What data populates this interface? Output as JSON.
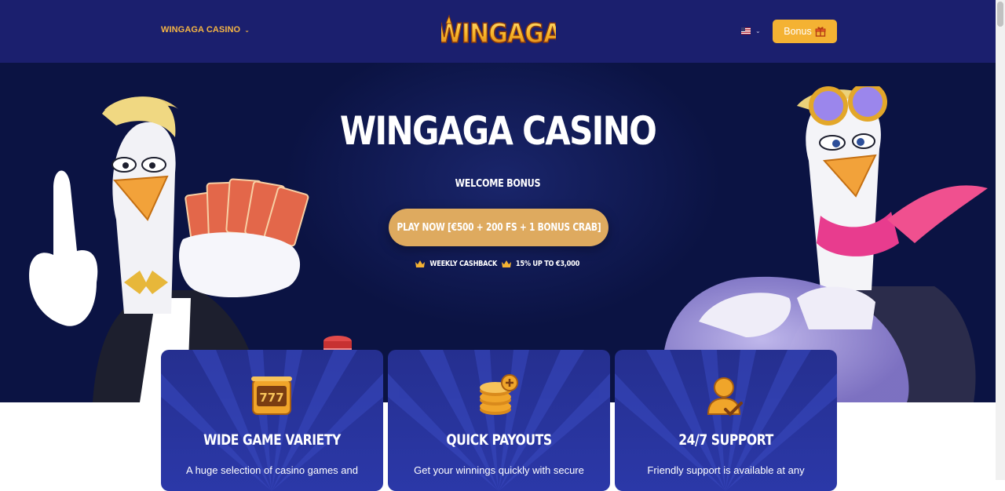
{
  "header": {
    "nav_label": "WINGAGA CASINO",
    "logo_text": "WINGAGA",
    "language_icon": "us-flag-icon",
    "bonus_label": "Bonus",
    "bonus_icon": "gift-icon"
  },
  "hero": {
    "title": "WINGAGA CASINO",
    "subtitle": "WELCOME BONUS",
    "cta_label": "PLAY NOW [€500 + 200 FS + 1 BONUS CRAB]",
    "perks": [
      "WEEKLY CASHBACK",
      "15% UP TO €3,000"
    ],
    "perk_icon": "crown-icon"
  },
  "features": [
    {
      "icon": "slot-777-icon",
      "title": "WIDE GAME VARIETY",
      "text": "A huge selection of casino games and"
    },
    {
      "icon": "coin-stack-icon",
      "title": "QUICK PAYOUTS",
      "text": "Get your winnings quickly with secure"
    },
    {
      "icon": "support-agent-icon",
      "title": "24/7 SUPPORT",
      "text": "Friendly support is available at any"
    }
  ],
  "colors": {
    "header_bg": "#1b1f6e",
    "hero_bg": "#0b1343",
    "accent": "#f4b233",
    "cta": "#deaa5f",
    "card_bg": "#2b38a8"
  }
}
